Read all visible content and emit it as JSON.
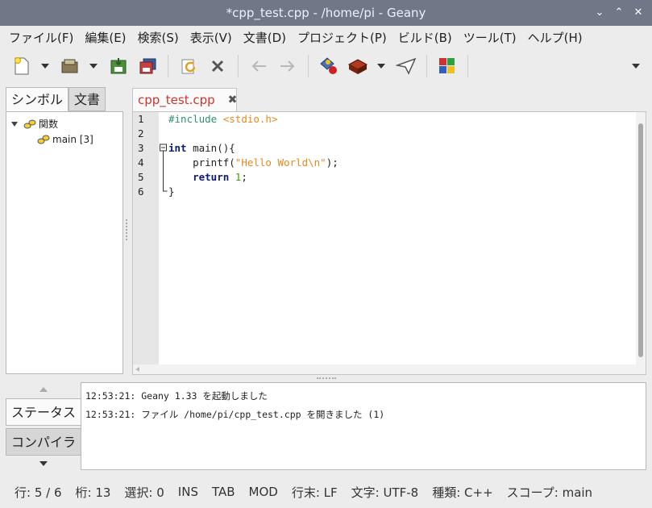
{
  "window": {
    "title": "*cpp_test.cpp - /home/pi - Geany",
    "controls": [
      "⌄",
      "⌃",
      "✕"
    ]
  },
  "menu": [
    "ファイル(F)",
    "編集(E)",
    "検索(S)",
    "表示(V)",
    "文書(D)",
    "プロジェクト(P)",
    "ビルド(B)",
    "ツール(T)",
    "ヘルプ(H)"
  ],
  "sidebar": {
    "tabs": [
      "シンボル",
      "文書"
    ],
    "tree": {
      "group": "関数",
      "item": "main [3]"
    }
  },
  "editor": {
    "tab_label": "cpp_test.cpp",
    "close_glyph": "✖",
    "line_numbers": [
      "1",
      "2",
      "3",
      "4",
      "5",
      "6"
    ],
    "code": {
      "l1_directive": "#include",
      "l1_header": "<stdio.h>",
      "l3_type": "int",
      "l3_rest": " main(){",
      "l4_pre": "    printf(",
      "l4_string": "\"Hello World\\n\"",
      "l4_post": ");",
      "l5_keyword": "    return",
      "l5_number": "1",
      "l5_post": ";",
      "l6": "}"
    },
    "colors": {
      "keyword": "#0c1a7a",
      "string": "#e8871b",
      "preprocessor": "#2f8f75",
      "number": "#3aa000"
    }
  },
  "messages": {
    "tabs": [
      "ステータス",
      "コンパイラ"
    ],
    "lines": [
      "12:53:21: Geany 1.33 を起動しました",
      "12:53:21: ファイル /home/pi/cpp_test.cpp を開きました (1)"
    ]
  },
  "status": {
    "line": "行: 5 / 6",
    "col": "桁: 13",
    "sel": "選択: 0",
    "ins": "INS",
    "tab": "TAB",
    "mod": "MOD",
    "eol": "行末: LF",
    "encoding": "文字: UTF-8",
    "filetype": "種類: C++",
    "scope": "スコープ: main"
  },
  "toolbar_icons": [
    "new-file-icon",
    "open-file-icon",
    "save-icon",
    "save-all-icon",
    "revert-icon",
    "close-icon",
    "back-icon",
    "forward-icon",
    "compile-icon",
    "build-icon",
    "execute-icon",
    "color-chooser-icon"
  ]
}
